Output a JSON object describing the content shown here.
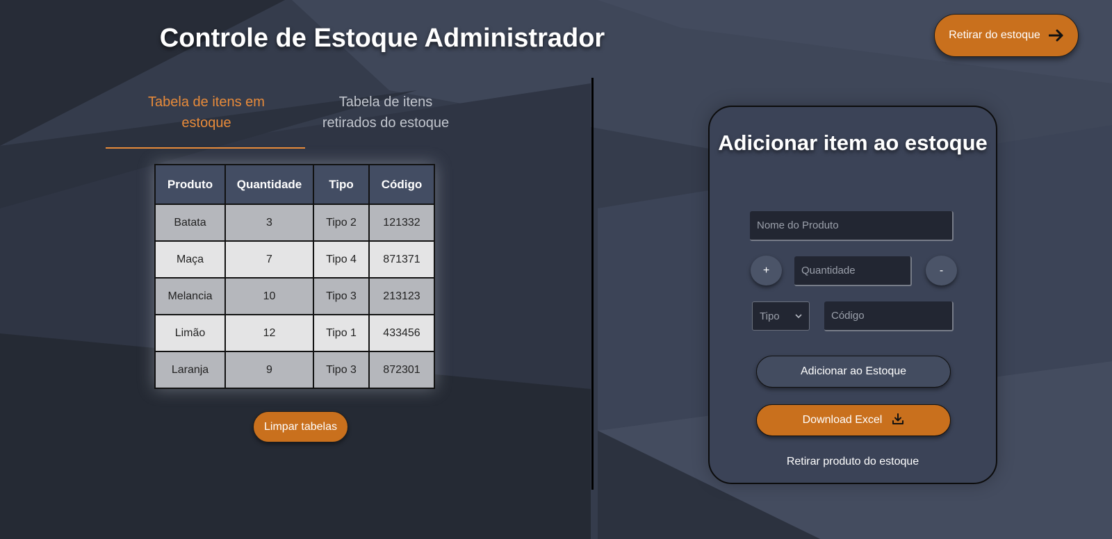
{
  "header": {
    "title": "Controle de Estoque Administrador",
    "withdraw_button": "Retirar do estoque"
  },
  "tabs": [
    {
      "label": "Tabela de itens em estoque",
      "active": true
    },
    {
      "label": "Tabela de itens retirados do estoque",
      "active": false
    }
  ],
  "table": {
    "headers": [
      "Produto",
      "Quantidade",
      "Tipo",
      "Código"
    ],
    "rows": [
      [
        "Batata",
        "3",
        "Tipo 2",
        "121332"
      ],
      [
        "Maça",
        "7",
        "Tipo 4",
        "871371"
      ],
      [
        "Melancia",
        "10",
        "Tipo 3",
        "213123"
      ],
      [
        "Limão",
        "12",
        "Tipo 1",
        "433456"
      ],
      [
        "Laranja",
        "9",
        "Tipo 3",
        "872301"
      ]
    ]
  },
  "clear_button": "Limpar tabelas",
  "form": {
    "title": "Adicionar item ao estoque",
    "name_placeholder": "Nome do Produto",
    "plus": "+",
    "quantity_placeholder": "Quantidade",
    "minus": "-",
    "type_select_value": "Tipo",
    "code_placeholder": "Código",
    "add_button": "Adicionar ao Estoque",
    "download_button": "Download Excel",
    "withdraw_link": "Retirar produto do estoque"
  },
  "icons": {
    "withdraw": "arrow-right-icon",
    "select": "chevron-down-icon",
    "download": "download-icon"
  },
  "colors": {
    "accent": "#c9701d",
    "active_tab": "#e88b3a",
    "table_header": "#434d63",
    "card_bg": "#3b4357"
  }
}
